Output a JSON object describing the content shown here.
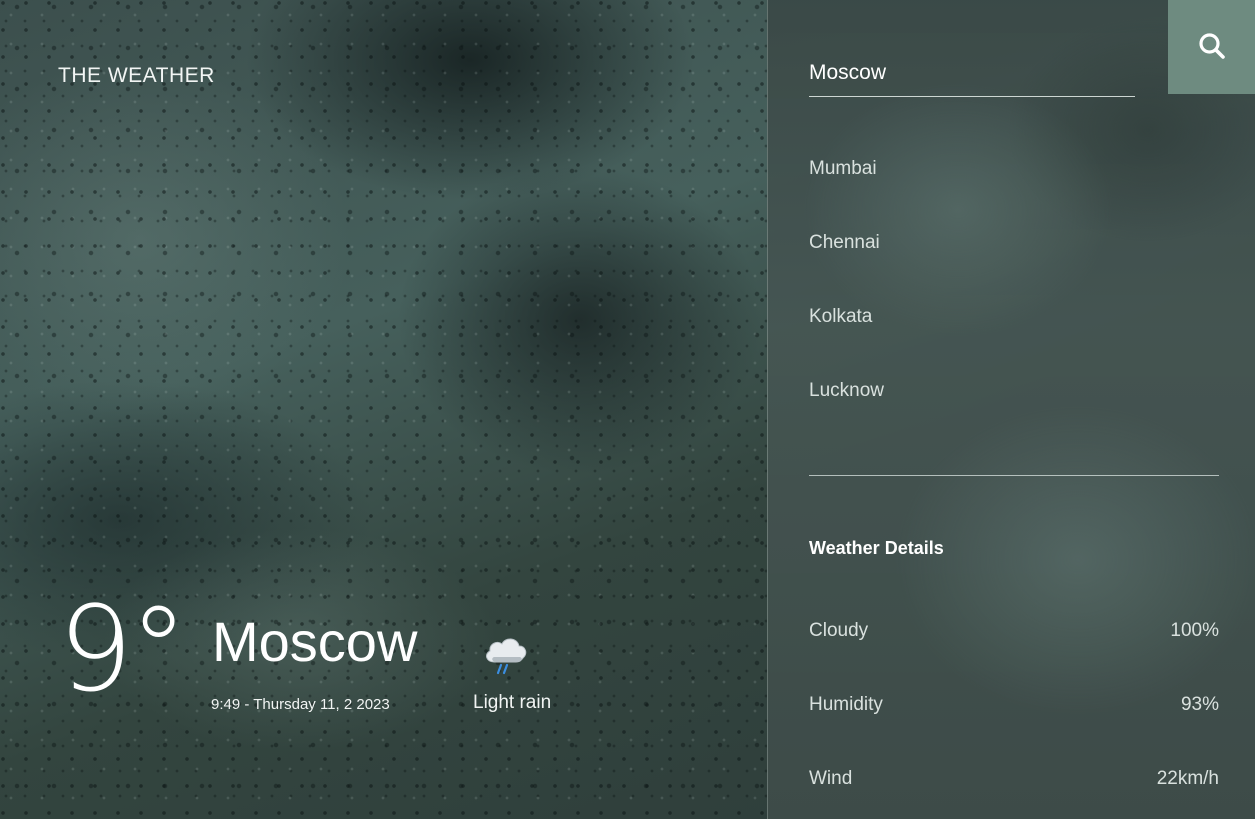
{
  "brand": {
    "title": "THE WEATHER"
  },
  "current": {
    "temperature": "9°",
    "city": "Moscow",
    "datetime": "9:49 - Thursday 11, 2 2023",
    "condition": "Light rain",
    "icon": "cloud-rain-icon"
  },
  "search": {
    "value": "Moscow",
    "icon": "search-icon"
  },
  "cities": [
    {
      "label": "Mumbai"
    },
    {
      "label": "Chennai"
    },
    {
      "label": "Kolkata"
    },
    {
      "label": "Lucknow"
    }
  ],
  "details": {
    "title": "Weather Details",
    "rows": [
      {
        "label": "Cloudy",
        "value": "100%"
      },
      {
        "label": "Humidity",
        "value": "93%"
      },
      {
        "label": "Wind",
        "value": "22km/h"
      }
    ]
  },
  "colors": {
    "search_button_bg": "#6e8b80",
    "text": "#ffffff",
    "muted_text": "#d9e1de"
  }
}
